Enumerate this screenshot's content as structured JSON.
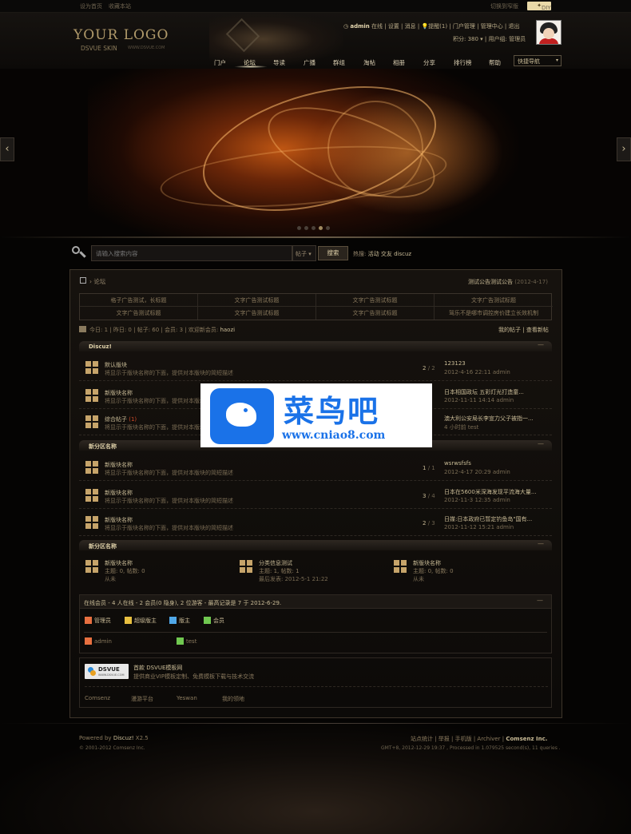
{
  "topbar": {
    "set_home": "设为首页",
    "bookmark": "收藏本站",
    "switch_style": "切换到窄版",
    "diy": "DIY"
  },
  "logo": {
    "text": "YOUR LOGO",
    "sub": "DSVUE SKIN",
    "sub2": "WWW.DSVUE.COM"
  },
  "user": {
    "name": "admin",
    "online": "在线",
    "links": [
      "设置",
      "消息",
      "提醒(1)",
      "门户管理",
      "管理中心",
      "退出"
    ],
    "points": "积分: 380",
    "group": "用户组: 管理员"
  },
  "nav": {
    "items": [
      "门户",
      "论坛",
      "导读",
      "广播",
      "群组",
      "淘帖",
      "相册",
      "分享",
      "排行榜",
      "帮助"
    ],
    "active": 1,
    "quick": "快捷导航"
  },
  "banner": {
    "prev": "‹",
    "next": "›",
    "slide_count": 5,
    "active_slide": 4
  },
  "search": {
    "placeholder": "请输入搜索内容",
    "type": "帖子",
    "button": "搜索",
    "hot_label": "热搜:",
    "hot": [
      "活动",
      "交友",
      "discuz"
    ]
  },
  "crumb": {
    "sep": "›",
    "label": "论坛"
  },
  "notice": {
    "text": "测试公告测试公告",
    "date": "(2012-4-17)"
  },
  "ads": [
    "格子广告测试，长标题",
    "文字广告测试标题",
    "文字广告测试标题",
    "文字广告测试标题",
    "文字广告测试标题",
    "文字广告测试标题",
    "文字广告测试标题",
    "驾乐不是哪市调控房价建立长效机制"
  ],
  "stats": {
    "text": "今日: 1 | 昨日: 0 | 帖子: 60 | 会员: 3 | 欢迎新会员:",
    "newuser": "haozi",
    "my_posts": "我的帖子",
    "sep": "|",
    "new_posts": "查看新帖"
  },
  "cat1": {
    "name": "Discuz!",
    "collapse": "—",
    "forums": [
      {
        "name": "默认版块",
        "hot": "",
        "desc": "将显示于版块名称的下面，提供对本版块的简短描述",
        "count": "2",
        "total": "2",
        "last_title": "123123",
        "last_meta": "2012-4-16 22:11 admin"
      },
      {
        "name": "新版块名称",
        "hot": "",
        "desc": "将显示于版块名称的下面，提供对本版块的简短描述",
        "count": "",
        "total": "",
        "last_title": "日本相国政坛 五彩灯光打造童...",
        "last_meta": "2012-11-11 14:14 admin"
      },
      {
        "name": "综合帖子",
        "hot": "(1)",
        "desc": "将显示于版块名称的下面，提供对本版块的简短描述",
        "count": "",
        "total": "",
        "last_title": "澳大利公安局长李宣力父子被指一...",
        "last_meta": "4 小时前 test"
      }
    ]
  },
  "cat2": {
    "name": "新分区名称",
    "collapse": "—",
    "forums": [
      {
        "name": "新版块名称",
        "hot": "",
        "desc": "将显示于版块名称的下面，提供对本版块的简短描述",
        "count": "1",
        "total": "1",
        "last_title": "wsrwsfsfs",
        "last_meta": "2012-4-17 20:29 admin"
      },
      {
        "name": "新版块名称",
        "hot": "",
        "desc": "将显示于版块名称的下面，提供对本版块的简短描述",
        "count": "3",
        "total": "4",
        "last_title": "日本在5600米深海发现平流海大量...",
        "last_meta": "2012-11-3 12:35 admin"
      },
      {
        "name": "新版块名称",
        "hot": "",
        "desc": "将显示于版块名称的下面，提供对本版块的简短描述",
        "count": "2",
        "total": "3",
        "last_title": "日媒:日本政府已暂定钓鱼岛\"国有...",
        "last_meta": "2012-11-12 15:21 admin"
      }
    ]
  },
  "cat3": {
    "name": "新分区名称",
    "collapse": "—",
    "forums": [
      {
        "name": "新版块名称",
        "l2": "主题: 0, 帖数: 0",
        "l3": "从未"
      },
      {
        "name": "分类信息测试",
        "l2": "主题: 1, 帖数: 1",
        "l3": "最后发表: 2012-5-1 21:22"
      },
      {
        "name": "新版块名称",
        "l2": "主题: 0, 帖数: 0",
        "l3": "从未"
      }
    ]
  },
  "online": {
    "head": "在线会员 - 4 人在线 - 2 会员(0 隐身), 2 位游客 - 最高记录是 7 于 2012-6-29.",
    "collapse": "—",
    "legend": [
      {
        "label": "管理员",
        "color": "#e87040"
      },
      {
        "label": "超级版主",
        "color": "#e8c040"
      },
      {
        "label": "版主",
        "color": "#50a8e8"
      },
      {
        "label": "会员",
        "color": "#70c850"
      }
    ],
    "users": [
      {
        "label": "admin",
        "color": "#e87040"
      },
      {
        "label": "test",
        "color": "#70c850"
      }
    ]
  },
  "partner": {
    "logo": "DSVUE",
    "logo_sub": "WWW.DSVUE.COM",
    "title": "首款 DSVUE模板网",
    "desc": "提供商业VIP模板定制、免费模板下载与技术交流",
    "links": [
      "Comsenz",
      "漫游平台",
      "Yeswan",
      "我的领地"
    ]
  },
  "footer": {
    "powered": "Powered by",
    "product": "Discuz!",
    "version": "X2.5",
    "copyright": "© 2001-2012 Comsenz Inc.",
    "links": "站点统计 | 举报 | 手机版 | Archiver |",
    "company": "Comsenz Inc.",
    "gmt": "GMT+8, 2012-12-29 19:37 , Processed in 1.079525 second(s), 11 queries ."
  },
  "watermark": {
    "text": "菜鸟吧",
    "url": "www.cniao8.com"
  }
}
